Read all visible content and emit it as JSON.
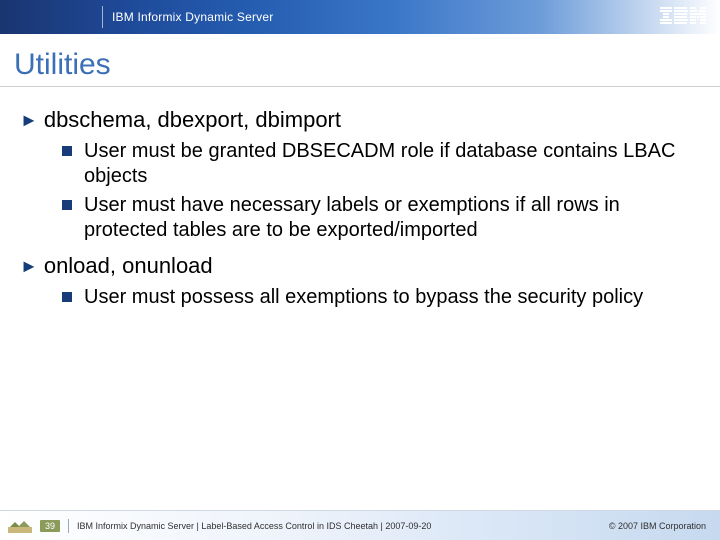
{
  "header": {
    "product": "IBM Informix Dynamic Server",
    "logo_name": "ibm-logo"
  },
  "title": "Utilities",
  "bullets": [
    {
      "text": "dbschema, dbexport, dbimport",
      "sub": [
        "User must be granted DBSECADM role if database contains LBAC objects",
        "User must have necessary labels or exemptions if all rows in protected tables are to be exported/imported"
      ]
    },
    {
      "text": "onload, onunload",
      "sub": [
        "User must possess all exemptions to bypass the security policy"
      ]
    }
  ],
  "footer": {
    "page": "39",
    "text": "IBM Informix Dynamic Server | Label-Based Access Control in IDS Cheetah | 2007-09-20",
    "copyright": "© 2007 IBM Corporation"
  }
}
